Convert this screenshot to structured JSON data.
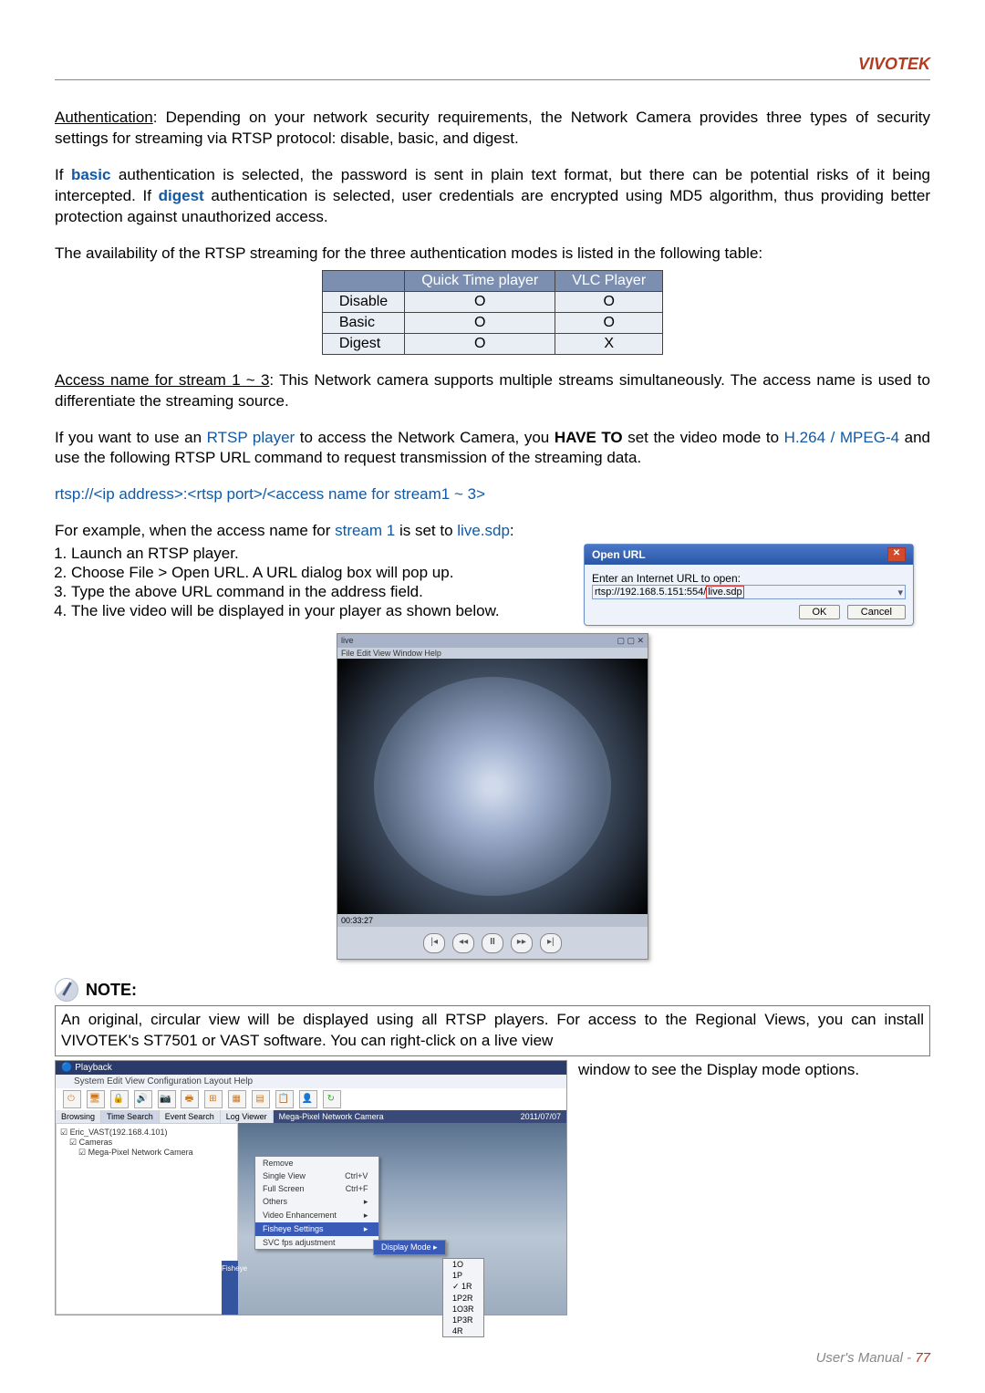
{
  "brand": "VIVOTEK",
  "intro1a": "Authentication",
  "intro1b": ": Depending on your network security requirements, the Network Camera provides three types of security settings for streaming via RTSP protocol: disable, basic, and digest.",
  "intro2a": "If ",
  "intro2_basic": "basic",
  "intro2b": " authentication is selected, the password is sent in plain text format, but there can be potential risks of it being intercepted. If ",
  "intro2_digest": "digest",
  "intro2c": " authentication is selected, user credentials are encrypted using MD5 algorithm, thus providing better protection against unauthorized access.",
  "intro3": "The availability of the RTSP streaming for the three authentication modes is listed in the following table:",
  "table": {
    "head": [
      "",
      "Quick Time player",
      "VLC Player"
    ],
    "rows": [
      [
        "Disable",
        "O",
        "O"
      ],
      [
        "Basic",
        "O",
        "O"
      ],
      [
        "Digest",
        "O",
        "X"
      ]
    ]
  },
  "access1a": "Access name for stream 1 ~ 3",
  "access1b": ": This Network camera supports multiple streams simultaneously. The access name is used to differentiate the streaming source.",
  "access2a": "If you want to use an ",
  "access2_rtsp": "RTSP player",
  "access2b": " to access the Network Camera, you ",
  "access2_have": "HAVE TO",
  "access2c": " set the video mode to ",
  "access2_codec": "H.264 / MPEG-4",
  "access2d": " and use the following RTSP URL command to request transmission of the streaming data.",
  "rtsp_url_fmt": "rtsp://<ip address>:<rtsp port>/<access name for stream1 ~ 3>",
  "example_a": "For example, when the access name for ",
  "example_s1": "stream 1",
  "example_b": " is set to ",
  "example_live": "live.sdp",
  "example_c": ":",
  "steps": [
    "Launch an RTSP player.",
    "Choose File > Open URL. A URL dialog box will pop up.",
    "Type the above URL command in the address field.",
    "The live video will be displayed in your player as shown below."
  ],
  "dialog": {
    "title": "Open URL",
    "label": "Enter an Internet URL to open:",
    "value_a": "rtsp://192.168.5.151:554/",
    "value_b": "live.sdp",
    "ok": "OK",
    "cancel": "Cancel"
  },
  "player": {
    "titlebar": "live",
    "menu": "File  Edit  View  Window  Help",
    "time": "00:33:27"
  },
  "note_title": "NOTE:",
  "note_text_a": "An original, circular view will be displayed using all RTSP players. For access to the Regional Views, you can install VIVOTEK's ST7501 or VAST software. You can right-click on a live view",
  "note_text_b": "window to see the Display mode options.",
  "vast": {
    "window_title": "Playback",
    "menu": "System   Edit   View   Configuration   Layout   Help",
    "tabs": [
      "Browsing",
      "Time Search",
      "Event Search",
      "Log Viewer"
    ],
    "video_title": "Mega-Pixel Network Camera",
    "date": "2011/07/07",
    "tree": [
      "☑ Eric_VAST(192.168.4.101)",
      "  ☑ Cameras",
      "    ☑ Mega-Pixel Network Camera"
    ],
    "ctx_items": [
      {
        "label": "Remove",
        "shortcut": ""
      },
      {
        "label": "Single View",
        "shortcut": "Ctrl+V"
      },
      {
        "label": "Full Screen",
        "shortcut": "Ctrl+F"
      },
      {
        "label": "Others",
        "shortcut": "▸"
      },
      {
        "label": "Video Enhancement",
        "shortcut": "▸"
      },
      {
        "label": "Fisheye Settings",
        "shortcut": "▸"
      },
      {
        "label": "SVC fps adjustment",
        "shortcut": ""
      }
    ],
    "submenu": [
      {
        "label": "Display Mode",
        "shortcut": "▸"
      }
    ],
    "sub2": [
      "1O",
      "1P",
      "✓ 1R",
      "1P2R",
      "1O3R",
      "1P3R",
      "4R"
    ],
    "fisheye_tab": "Fisheye"
  },
  "footer": {
    "label": "User's Manual - ",
    "page": "77"
  }
}
